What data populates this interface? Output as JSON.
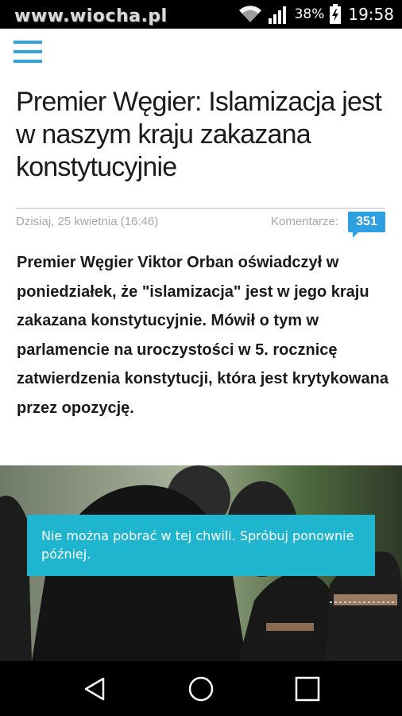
{
  "status_bar": {
    "watermark": "www.wiocha.pl",
    "battery_percent": "38%",
    "time": "19:58",
    "icons": [
      "wifi-icon",
      "signal-icon",
      "battery-charging-icon"
    ]
  },
  "header": {
    "menu_icon": "hamburger-menu-icon",
    "accent_color": "#2ea3e0"
  },
  "article": {
    "title": "Premier Węgier: Islamizacja jest w naszym kraju zakazana konstytucyjnie",
    "date": "Dzisiaj, 25 kwietnia (16:46)",
    "comments_label": "Komentarze:",
    "comments_count": "351",
    "lead": "Premier Węgier Viktor Orban oświadczył w poniedziałek, że \"islamizacja\" jest w jego kraju zakazana konstytucyjnie. Mówił o tym w parlamencie na uroczystości w 5. rocznicę zatwierdzenia konstytucji, która jest krytykowana przez opozycję."
  },
  "toast": {
    "message": "Nie można pobrać w tej chwili. Spróbuj ponownie później.",
    "color": "#1fb5cf"
  },
  "nav_bar": {
    "icons": [
      "back-icon",
      "home-icon",
      "recents-icon"
    ]
  }
}
